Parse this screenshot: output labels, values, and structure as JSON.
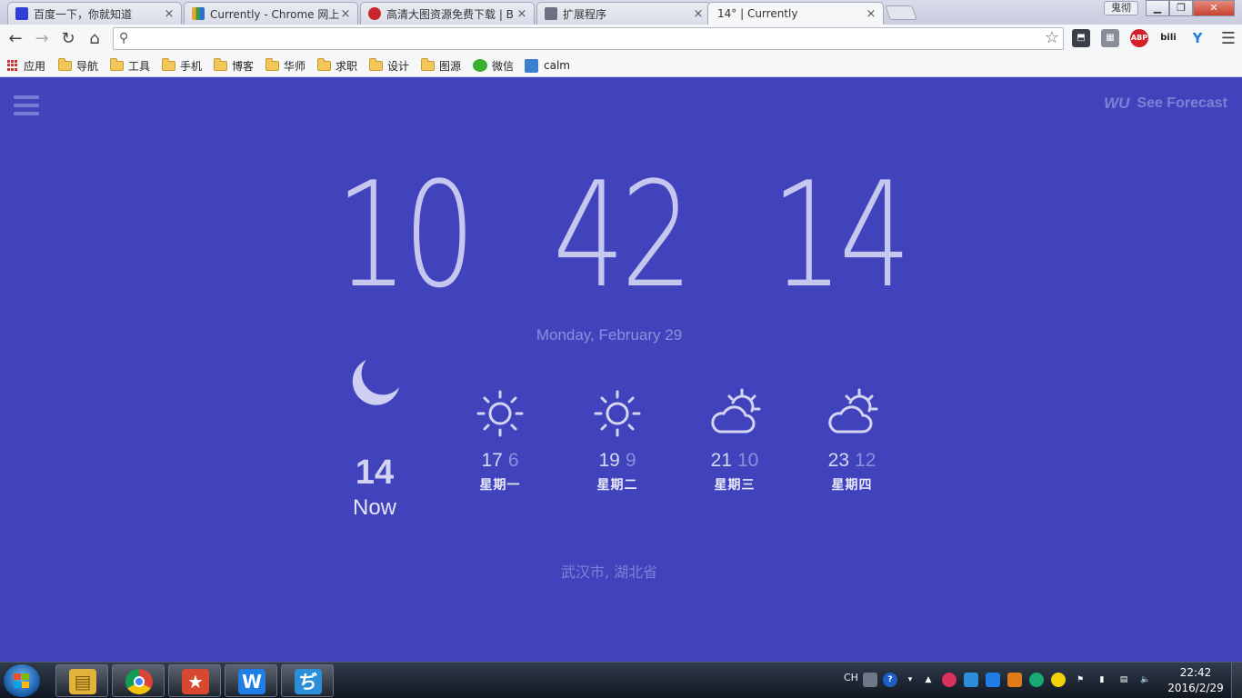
{
  "browser": {
    "tabs": [
      {
        "label": "百度一下，你就知道",
        "favicon_color": "#2f3fd3",
        "active": false
      },
      {
        "label": "Currently - Chrome 网上",
        "favicon_color": "#e8a72c",
        "active": false
      },
      {
        "label": "高清大图资源免费下载 | B",
        "favicon_color": "#c8282b",
        "active": false
      },
      {
        "label": "扩展程序",
        "favicon_color": "#6d7080",
        "active": false
      },
      {
        "label": "14° | Currently",
        "favicon_color": "#4143bd",
        "active": true
      }
    ],
    "close_glyph": "×",
    "user_badge": "鬼彻",
    "window_buttons": {
      "minimize": "▁",
      "maximize": "❐",
      "close": "✕"
    },
    "omnibox": {
      "value": "",
      "placeholder": ""
    },
    "extensions": [
      {
        "name": "pocket-icon",
        "color": "#3c3f47",
        "glyph": "⬒"
      },
      {
        "name": "tab-manager-icon",
        "color": "#8a8d98",
        "glyph": "▦"
      },
      {
        "name": "adblock-plus-icon",
        "color": "#d3202a",
        "glyph": "ABP"
      },
      {
        "name": "bilibili-icon",
        "color": "#2a2a2a",
        "glyph": "bili"
      },
      {
        "name": "extension-y-icon",
        "color": "#1f7fd6",
        "glyph": "Y"
      }
    ],
    "bookmarks": [
      {
        "label": "应用",
        "type": "apps"
      },
      {
        "label": "导航",
        "type": "folder"
      },
      {
        "label": "工具",
        "type": "folder"
      },
      {
        "label": "手机",
        "type": "folder"
      },
      {
        "label": "博客",
        "type": "folder"
      },
      {
        "label": "华师",
        "type": "folder"
      },
      {
        "label": "求职",
        "type": "folder"
      },
      {
        "label": "设计",
        "type": "folder"
      },
      {
        "label": "图源",
        "type": "folder"
      },
      {
        "label": "微信",
        "type": "wechat"
      },
      {
        "label": "calm",
        "type": "site"
      }
    ]
  },
  "currently": {
    "menu_icon": "hamburger-icon",
    "see_forecast": {
      "logo": "WU",
      "label": "See Forecast"
    },
    "clock": {
      "hours": "10",
      "minutes": "42",
      "seconds": "14"
    },
    "date": "Monday, February 29",
    "now": {
      "icon": "moon-icon",
      "temp": "14",
      "label": "Now"
    },
    "forecast": [
      {
        "icon": "sun",
        "hi": "17",
        "lo": "6",
        "day": "星期一"
      },
      {
        "icon": "sun",
        "hi": "19",
        "lo": "9",
        "day": "星期二"
      },
      {
        "icon": "partly-cloudy",
        "hi": "21",
        "lo": "10",
        "day": "星期三"
      },
      {
        "icon": "partly-cloudy",
        "hi": "23",
        "lo": "12",
        "day": "星期四"
      }
    ],
    "location": "武汉市, 湖北省",
    "colors": {
      "background": "#4143bd",
      "text": "#d7d8f3",
      "muted": "#8d8fdc"
    }
  },
  "taskbar": {
    "pinned": [
      {
        "name": "file-explorer",
        "color": "#e2b33a",
        "glyph": "▤"
      },
      {
        "name": "chrome",
        "color": "#db4437",
        "glyph": ""
      },
      {
        "name": "wunderlist",
        "color": "#d8472f",
        "glyph": "★"
      },
      {
        "name": "wps-writer",
        "color": "#1e7ee6",
        "glyph": "W"
      },
      {
        "name": "sogou-input",
        "color": "#2a8fd8",
        "glyph": "ぢ"
      }
    ],
    "tray": {
      "language": "CH",
      "help": "?",
      "time": "22:42",
      "date": "2016/2/29"
    }
  }
}
